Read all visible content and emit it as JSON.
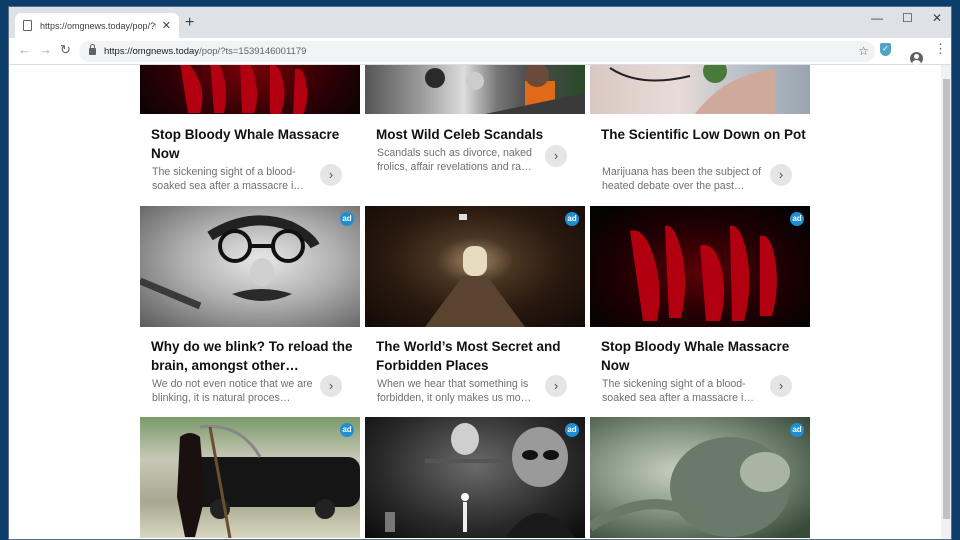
{
  "browser": {
    "tab_title": "https://omgnews.today/pop/?ts=",
    "url_host": "https://omgnews.today",
    "url_path": "/pop/?ts=1539146001179",
    "new_tab_label": "+",
    "minimize": "—",
    "maximize": "☐",
    "close": "✕"
  },
  "cards": [
    {
      "title": "Stop Bloody Whale Massacre Now",
      "desc": "The sickening sight of a blood-soaked sea after a massacre i…",
      "ad": ""
    },
    {
      "title": "Most Wild Celeb Scandals",
      "desc": "Scandals such as divorce, naked frolics, affair revelations and ra…",
      "ad": ""
    },
    {
      "title": "The Scientific Low Down on Pot",
      "desc": "Marijuana has been the subject of heated debate over the past…",
      "ad": ""
    },
    {
      "title": "Why do we blink? To reload the brain, amongst other…",
      "desc": "We do not even notice that we are blinking, it is natural proces…",
      "ad": "ad"
    },
    {
      "title": "The World’s Most Secret and Forbidden Places",
      "desc": "When we hear that something is forbidden, it only makes us mo…",
      "ad": "ad"
    },
    {
      "title": "Stop Bloody Whale Massacre Now",
      "desc": "The sickening sight of a blood-soaked sea after a massacre i…",
      "ad": "ad"
    },
    {
      "title": "",
      "desc": "",
      "ad": "ad"
    },
    {
      "title": "",
      "desc": "",
      "ad": "ad"
    },
    {
      "title": "",
      "desc": "",
      "ad": "ad"
    }
  ]
}
